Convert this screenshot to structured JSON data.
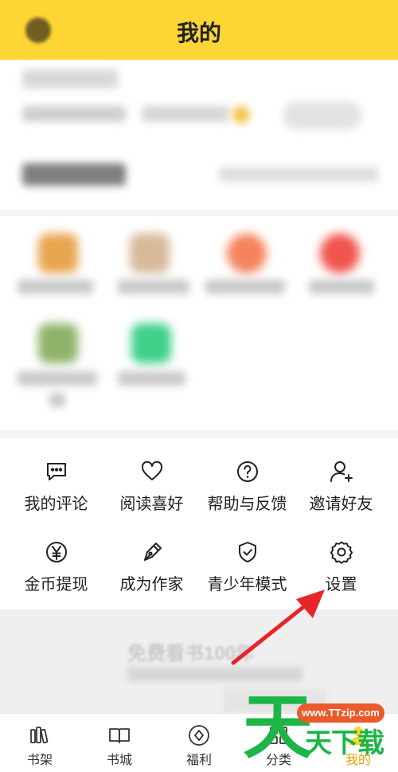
{
  "header": {
    "title": "我的"
  },
  "tools": [
    {
      "label": "我的评论",
      "icon": "comment-icon"
    },
    {
      "label": "阅读喜好",
      "icon": "heart-icon"
    },
    {
      "label": "帮助与反馈",
      "icon": "help-icon"
    },
    {
      "label": "邀请好友",
      "icon": "invite-user-icon"
    },
    {
      "label": "金币提现",
      "icon": "yen-coin-icon"
    },
    {
      "label": "成为作家",
      "icon": "pen-icon"
    },
    {
      "label": "青少年模式",
      "icon": "shield-check-icon"
    },
    {
      "label": "设置",
      "icon": "gear-icon"
    }
  ],
  "banner": {
    "text": "免费看书100年"
  },
  "tabbar": [
    {
      "label": "书架",
      "icon": "bookshelf-icon"
    },
    {
      "label": "书城",
      "icon": "book-icon"
    },
    {
      "label": "福利",
      "icon": "gift-diamond-icon"
    },
    {
      "label": "分类",
      "icon": "category-icon"
    },
    {
      "label": "我的",
      "icon": "profile-icon",
      "active": true
    }
  ],
  "watermark": {
    "big": "天",
    "pill": "www.TTzip.com",
    "small": "天下载"
  },
  "colors": {
    "accent": "#fdd635",
    "active_tab": "#e0a300",
    "arrow": "#e8242b",
    "watermark_green": "#1db548"
  }
}
